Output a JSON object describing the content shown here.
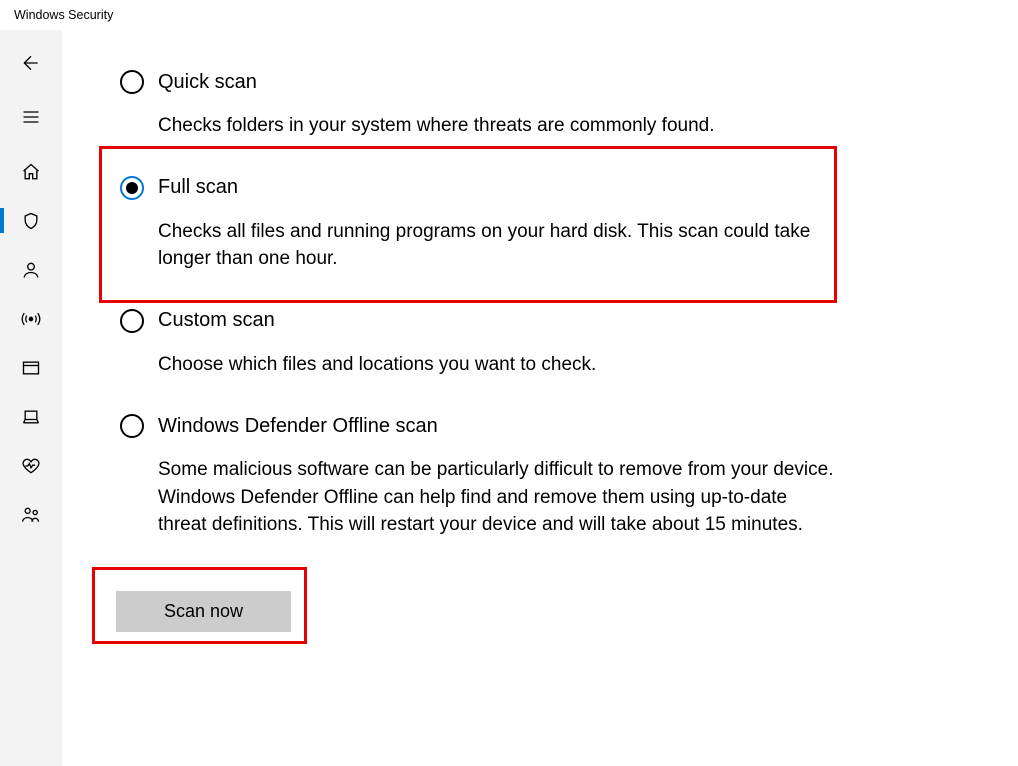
{
  "window": {
    "title": "Windows Security"
  },
  "options": {
    "quick": {
      "title": "Quick scan",
      "desc": "Checks folders in your system where threats are commonly found."
    },
    "full": {
      "title": "Full scan",
      "desc": "Checks all files and running programs on your hard disk. This scan could take longer than one hour."
    },
    "custom": {
      "title": "Custom scan",
      "desc": "Choose which files and locations you want to check."
    },
    "offline": {
      "title": "Windows Defender Offline scan",
      "desc": "Some malicious software can be particularly difficult to remove from your device. Windows Defender Offline can help find and remove them using up-to-date threat definitions. This will restart your device and will take about 15 minutes."
    }
  },
  "actions": {
    "scan_now": "Scan now"
  }
}
